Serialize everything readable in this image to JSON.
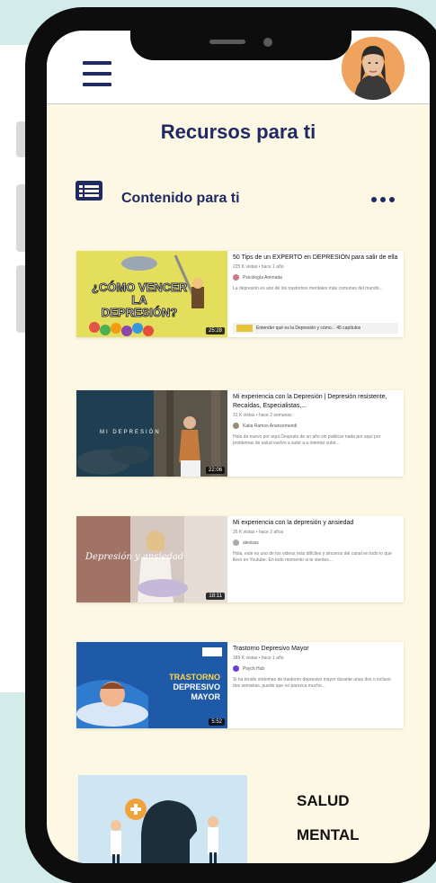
{
  "header": {
    "menu_icon": "hamburger-icon",
    "avatar_icon": "user-avatar"
  },
  "page": {
    "title": "Recursos para ti"
  },
  "section": {
    "icon": "list-icon",
    "title": "Contenido para ti",
    "more_icon": "more-horizontal-icon"
  },
  "videos": [
    {
      "thumb_text_1": "¿CÓMO VENCER LA",
      "thumb_text_2": "DEPRESIÓN?",
      "duration": "25:28",
      "title": "50 Tips de un EXPERTO en DEPRESIÓN para salir de ella",
      "meta": "225 K vistas • hace 1 año",
      "channel": "Psicología Animada",
      "description": "La depresión es uno de los trastornos mentales más comunes del mundo...",
      "chapters": "Entender qué es la Depresión y cómo...   45 capítulos"
    },
    {
      "thumb_text_1": "MI DEPRESIÓN",
      "duration": "22:06",
      "title": "Mi experiencia con la Depresión | Depresión resistente, Recaídas, Especialistas,...",
      "meta": "31 K vistas • hace 2 semanas",
      "channel": "Katia Ramos Ananzemendi",
      "description": "Hola de nuevo por aquí Después de un año sin publicar nada por aquí por problemas de salud vuelvo a subir a a intentar subir..."
    },
    {
      "thumb_text_1": "Depresión y ansiedad",
      "duration": "18:11",
      "title": "Mi experiencia con la depresión y ansiedad",
      "meta": "26 K vistas • hace 2 años",
      "channel": "alexisss",
      "description": "Hola, este es uno de los videos más difíciles y sinceros del canal en todo lo que llevo en Youtube. En todo momento si te sientes..."
    },
    {
      "thumb_text_1": "TRASTORNO",
      "thumb_text_2": "DEPRESIVO",
      "thumb_text_3": "MAYOR",
      "duration": "5:52",
      "title": "Trastorno Depresivo Mayor",
      "meta": "189 K vistas • hace 1 año",
      "channel": "Psych Hub",
      "description": "Si ha tenido síntomas de trastorno depresivo mayor durante unas dos o incluso dos semanas, puede que no parezca mucho..."
    }
  ],
  "bottom": {
    "line1": "SALUD",
    "line2": "MENTAL"
  },
  "colors": {
    "primary": "#1f2a62",
    "screen_bg": "#fdf8e3",
    "teal": "#d3ecea"
  }
}
